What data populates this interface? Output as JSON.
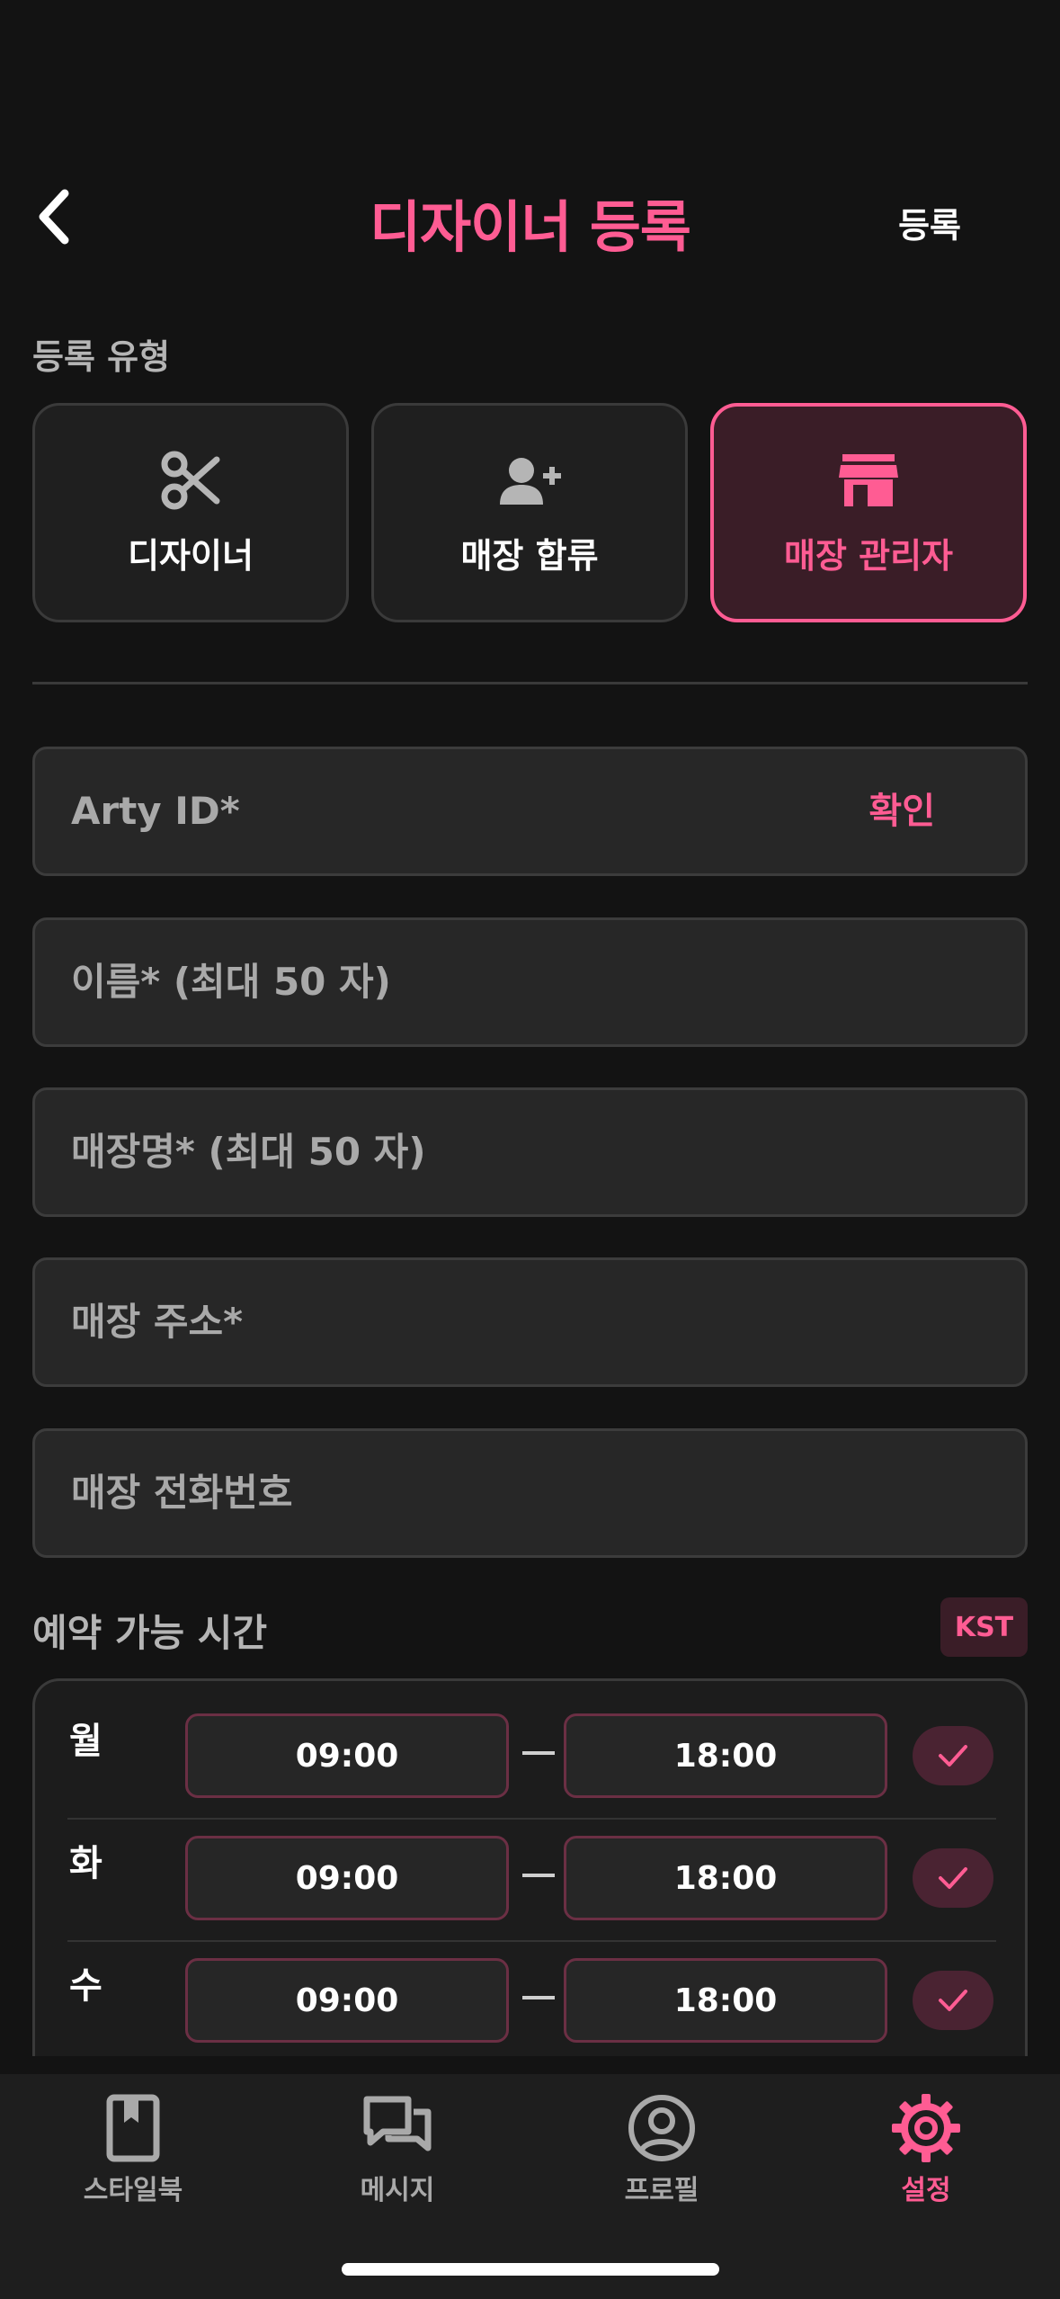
{
  "header": {
    "title": "디자이너 등록",
    "action": "등록"
  },
  "register_type": {
    "label": "등록 유형",
    "options": [
      {
        "label": "디자이너",
        "icon": "scissors-icon"
      },
      {
        "label": "매장 합류",
        "icon": "user-plus-icon"
      },
      {
        "label": "매장 관리자",
        "icon": "store-icon",
        "selected": true
      }
    ]
  },
  "fields": {
    "arty_id": {
      "placeholder": "Arty ID*",
      "confirm_label": "확인"
    },
    "name": {
      "placeholder": "이름* (최대 50 자)"
    },
    "store_name": {
      "placeholder": "매장명* (최대 50 자)"
    },
    "store_address": {
      "placeholder": "매장 주소*"
    },
    "store_phone": {
      "placeholder": "매장 전화번호"
    }
  },
  "hours": {
    "label": "예약 가능 시간",
    "timezone": "KST",
    "days": [
      {
        "day": "월",
        "start": "09:00",
        "end": "18:00",
        "enabled": true
      },
      {
        "day": "화",
        "start": "09:00",
        "end": "18:00",
        "enabled": true
      },
      {
        "day": "수",
        "start": "09:00",
        "end": "18:00",
        "enabled": true
      }
    ]
  },
  "tabbar": {
    "items": [
      {
        "label": "스타일북",
        "icon": "book-icon"
      },
      {
        "label": "메시지",
        "icon": "message-icon"
      },
      {
        "label": "프로필",
        "icon": "profile-icon"
      },
      {
        "label": "설정",
        "icon": "gear-icon",
        "active": true
      }
    ]
  },
  "colors": {
    "accent": "#ff5c93",
    "background": "#131313",
    "field": "#272727"
  }
}
